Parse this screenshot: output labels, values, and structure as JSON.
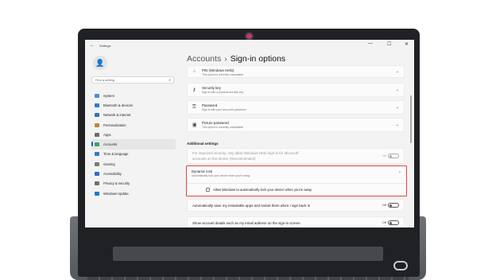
{
  "window": {
    "title": "Settings",
    "controls": [
      "—",
      "☐",
      "✕"
    ]
  },
  "sidebar": {
    "search_placeholder": "Find a setting",
    "items": [
      {
        "label": "System",
        "icon": "monitor-icon",
        "color": "#4a90d9"
      },
      {
        "label": "Bluetooth & devices",
        "icon": "bluetooth-icon",
        "color": "#2b7cd3"
      },
      {
        "label": "Network & internet",
        "icon": "network-icon",
        "color": "#3b6fb5"
      },
      {
        "label": "Personalization",
        "icon": "brush-icon",
        "color": "#c2833c"
      },
      {
        "label": "Apps",
        "icon": "apps-icon",
        "color": "#6b6b6b"
      },
      {
        "label": "Accounts",
        "icon": "person-icon",
        "color": "#3aa35b",
        "active": true
      },
      {
        "label": "Time & language",
        "icon": "globe-icon",
        "color": "#2c7bd6"
      },
      {
        "label": "Gaming",
        "icon": "controller-icon",
        "color": "#7a7a7a"
      },
      {
        "label": "Accessibility",
        "icon": "accessibility-icon",
        "color": "#2a6fc9"
      },
      {
        "label": "Privacy & security",
        "icon": "shield-icon",
        "color": "#6f6f6f"
      },
      {
        "label": "Windows Update",
        "icon": "update-icon",
        "color": "#1e78d0"
      }
    ]
  },
  "breadcrumb": {
    "parent": "Accounts",
    "separator": "›",
    "current": "Sign-in options"
  },
  "options": [
    {
      "title": "PIN (Windows Hello)",
      "subtitle": "This option is currently unavailable",
      "icon": "pin-icon"
    },
    {
      "title": "Security key",
      "subtitle": "Sign in with a physical security key",
      "icon": "key-icon"
    },
    {
      "title": "Password",
      "subtitle": "Sign in with your account's password",
      "icon": "password-icon"
    },
    {
      "title": "Picture password",
      "subtitle": "This option is currently unavailable",
      "icon": "picture-icon"
    }
  ],
  "additional": {
    "heading": "Additional settings",
    "hello_only": {
      "line1": "For improved security, only allow Windows Hello sign-in for Microsoft",
      "line2": "accounts on this device (Recommended)",
      "state": "On"
    },
    "dynamic_lock": {
      "title": "Dynamic lock",
      "subtitle": "Automatically lock your device when you're away",
      "checkbox_label": "Allow Windows to automatically lock your device when you're away"
    },
    "restartable_apps": {
      "label": "Automatically save my restartable apps and restart them when I sign back in",
      "state": "Off"
    },
    "account_details": {
      "label": "Show account details such as my email address on the sign-in screen.",
      "state": "Off"
    }
  }
}
